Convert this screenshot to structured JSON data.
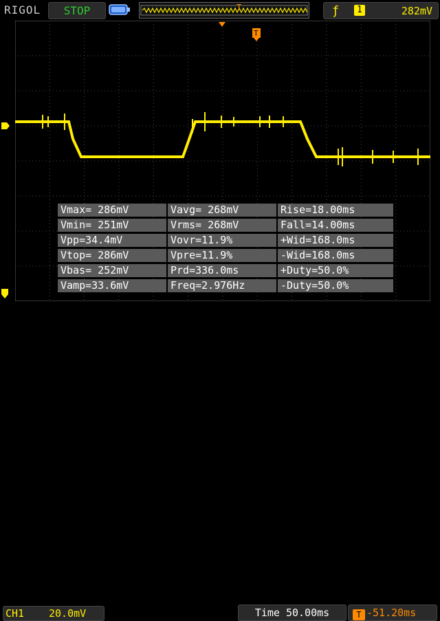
{
  "header": {
    "brand": "RIGOL",
    "run_state": "STOP",
    "trigger_source": "1",
    "trigger_level": "282mV",
    "trigger_marker": "T"
  },
  "channel": {
    "label": "CH1",
    "scale": "20.0mV"
  },
  "timebase": {
    "label": "Time",
    "value": "50.00ms",
    "offset": "-51.20ms"
  },
  "measurements": [
    [
      "Vmax= 286mV",
      "Vavg= 268mV",
      "Rise=18.00ms"
    ],
    [
      "Vmin= 251mV",
      "Vrms= 268mV",
      "Fall=14.00ms"
    ],
    [
      "Vpp=34.4mV",
      "Vovr=11.9%",
      "+Wid=168.0ms"
    ],
    [
      "Vtop= 286mV",
      "Vpre=11.9%",
      "-Wid=168.0ms"
    ],
    [
      "Vbas= 252mV",
      "Prd=336.0ms",
      "+Duty=50.0%"
    ],
    [
      "Vamp=33.6mV",
      "Freq=2.976Hz",
      "-Duty=50.0%"
    ]
  ],
  "waveform": {
    "color": "#ffee00",
    "high_level_mV": 286,
    "low_level_mV": 252
  },
  "colors": {
    "trace": "#ffee00",
    "run_state": "#2ec82e",
    "offset": "#ff8a00",
    "grid": "#4a4a4a"
  }
}
